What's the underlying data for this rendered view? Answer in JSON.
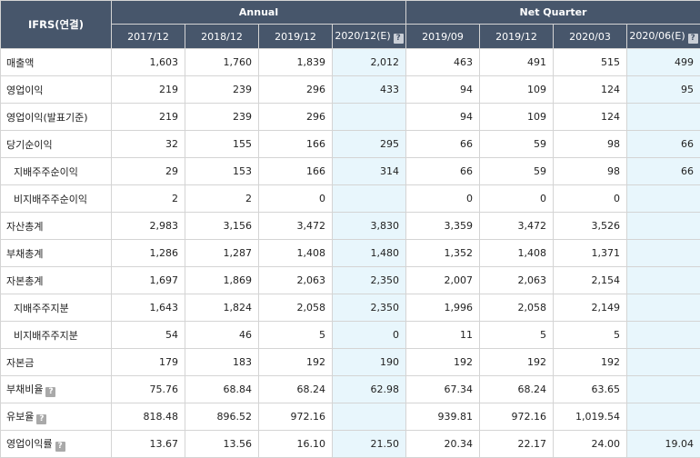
{
  "header": {
    "ifrs_label": "IFRS(연결)",
    "annual_label": "Annual",
    "quarter_label": "Net Quarter",
    "periods": [
      "2017/12",
      "2018/12",
      "2019/12",
      "2020/12(E)",
      "2019/09",
      "2019/12",
      "2020/03",
      "2020/06(E)"
    ]
  },
  "rows": [
    {
      "label": "매출액",
      "values": [
        "1,603",
        "1,760",
        "1,839",
        "2,012",
        "463",
        "491",
        "515",
        "499"
      ]
    },
    {
      "label": "영업이익",
      "values": [
        "219",
        "239",
        "296",
        "433",
        "94",
        "109",
        "124",
        "95"
      ]
    },
    {
      "label": "영업이익(발표기준)",
      "values": [
        "219",
        "239",
        "296",
        "",
        "94",
        "109",
        "124",
        ""
      ]
    },
    {
      "label": "당기순이익",
      "values": [
        "32",
        "155",
        "166",
        "295",
        "66",
        "59",
        "98",
        "66"
      ]
    },
    {
      "label": "지배주주순이익",
      "values": [
        "29",
        "153",
        "166",
        "314",
        "66",
        "59",
        "98",
        "66"
      ]
    },
    {
      "label": "비지배주주순이익",
      "values": [
        "2",
        "2",
        "0",
        "",
        "0",
        "0",
        "0",
        ""
      ]
    },
    {
      "label": "자산총계",
      "values": [
        "2,983",
        "3,156",
        "3,472",
        "3,830",
        "3,359",
        "3,472",
        "3,526",
        ""
      ]
    },
    {
      "label": "부채총계",
      "values": [
        "1,286",
        "1,287",
        "1,408",
        "1,480",
        "1,352",
        "1,408",
        "1,371",
        ""
      ]
    },
    {
      "label": "자본총계",
      "values": [
        "1,697",
        "1,869",
        "2,063",
        "2,350",
        "2,007",
        "2,063",
        "2,154",
        ""
      ]
    },
    {
      "label": "지배주주지분",
      "values": [
        "1,643",
        "1,824",
        "2,058",
        "2,350",
        "1,996",
        "2,058",
        "2,149",
        ""
      ]
    },
    {
      "label": "비지배주주지분",
      "values": [
        "54",
        "46",
        "5",
        "0",
        "11",
        "5",
        "5",
        ""
      ]
    },
    {
      "label": "자본금",
      "values": [
        "179",
        "183",
        "192",
        "190",
        "192",
        "192",
        "192",
        ""
      ]
    },
    {
      "label": "부채비율",
      "values": [
        "75.76",
        "68.84",
        "68.24",
        "62.98",
        "67.34",
        "68.24",
        "63.65",
        ""
      ]
    },
    {
      "label": "유보율",
      "values": [
        "818.48",
        "896.52",
        "972.16",
        "",
        "939.81",
        "972.16",
        "1,019.54",
        ""
      ]
    },
    {
      "label": "영업이익률",
      "values": [
        "13.67",
        "13.56",
        "16.10",
        "21.50",
        "20.34",
        "22.17",
        "24.00",
        "19.04"
      ]
    }
  ]
}
